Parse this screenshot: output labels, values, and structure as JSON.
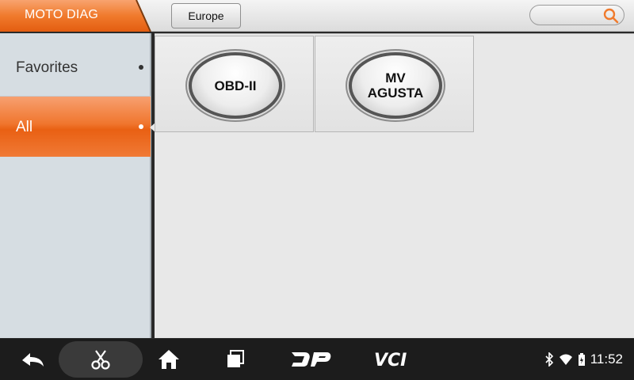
{
  "header": {
    "app_title": "MOTO DIAG",
    "region_button": "Europe",
    "accent_color": "#f07a2c",
    "search_icon": "search-icon"
  },
  "sidebar": {
    "items": [
      {
        "label": "Favorites",
        "selected": false
      },
      {
        "label": "All",
        "selected": true
      }
    ]
  },
  "main": {
    "tiles": [
      {
        "label": "OBD-II"
      },
      {
        "label_line1": "MV",
        "label_line2": "AGUSTA"
      }
    ]
  },
  "navbar": {
    "icons": [
      "back-icon",
      "scissors-icon",
      "home-icon",
      "recent-apps-icon",
      "dp-icon",
      "vci-icon"
    ],
    "dp_label": "DP",
    "vci_label": "VCI"
  },
  "status": {
    "icons": [
      "bluetooth-icon",
      "wifi-icon",
      "battery-icon"
    ],
    "time": "11:52"
  }
}
